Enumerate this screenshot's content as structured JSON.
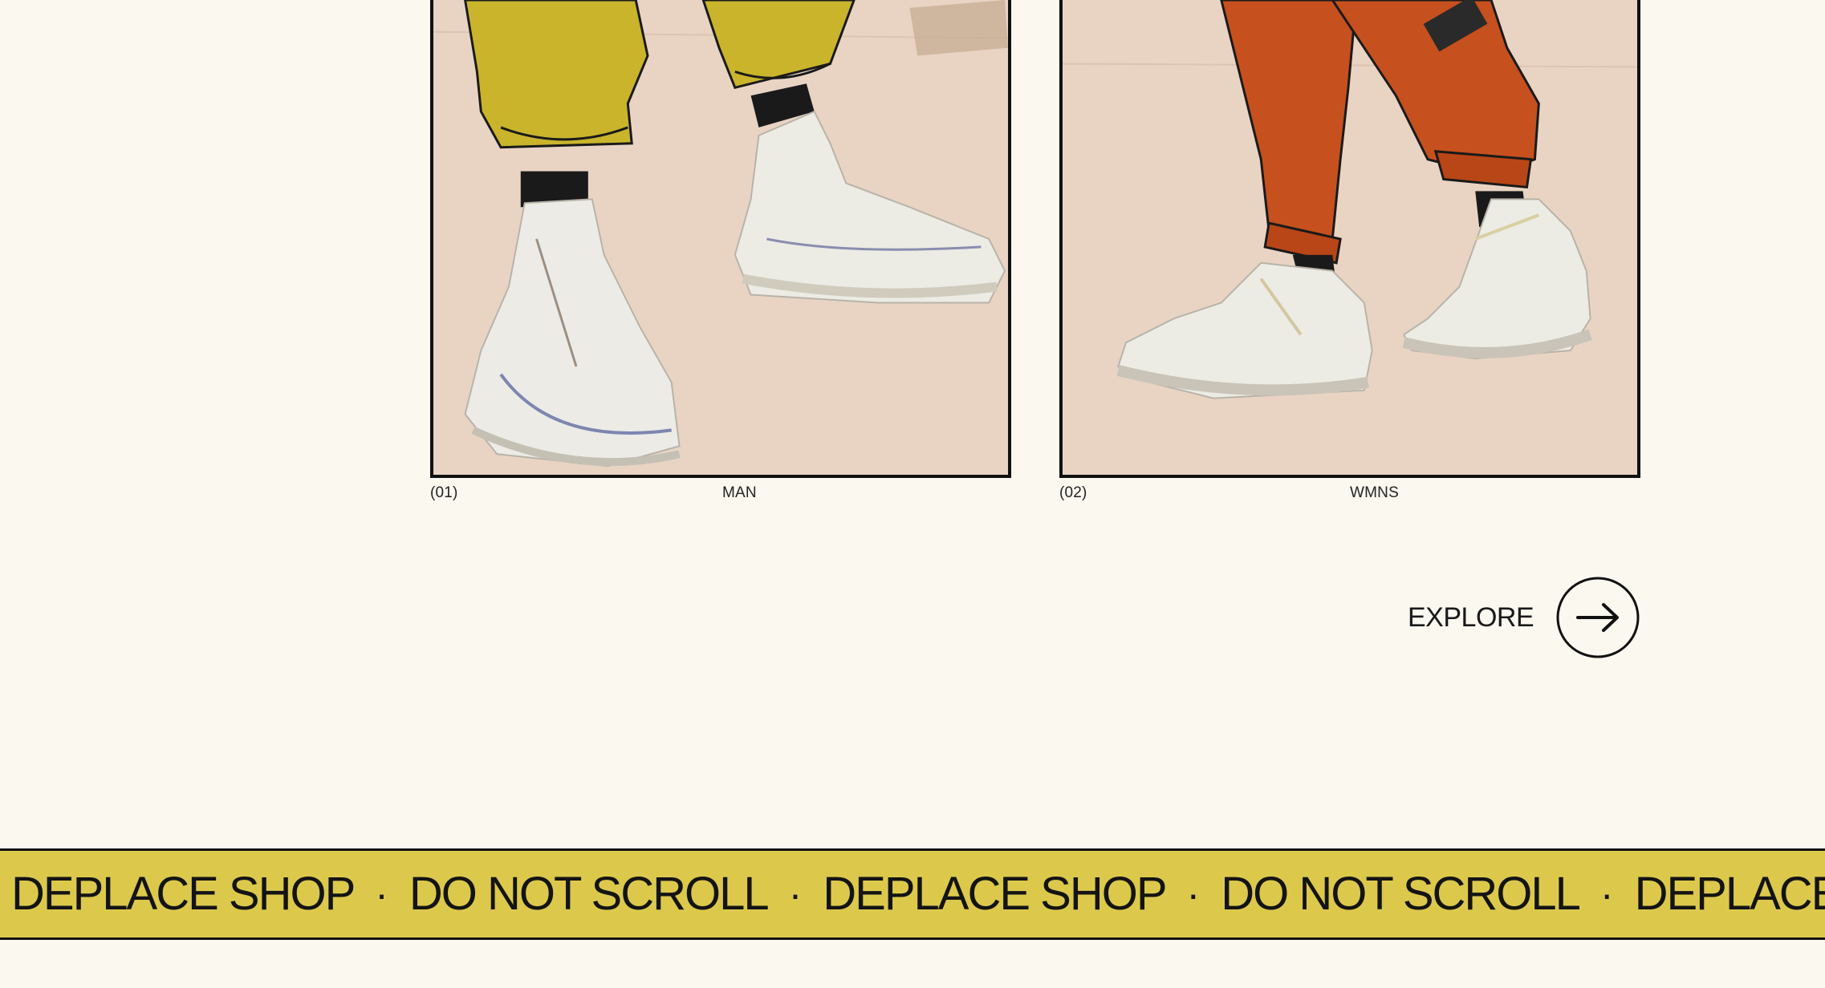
{
  "categories": [
    {
      "number": "(01)",
      "label": "MAN"
    },
    {
      "number": "(02)",
      "label": "WMNS"
    }
  ],
  "explore": {
    "label": "EXPLORE",
    "icon": "arrow-right-icon"
  },
  "marquee": {
    "items": [
      "DEPLACE SHOP",
      "DO NOT SCROLL",
      "DEPLACE SHOP",
      "DO NOT SCROLL",
      "DEPLACE SHOP"
    ],
    "separator": "·",
    "background": "#dcc94c"
  },
  "colors": {
    "page_background": "#fbf8f0",
    "man_pants": "#c9b42c",
    "wmns_pants": "#c6501e"
  }
}
